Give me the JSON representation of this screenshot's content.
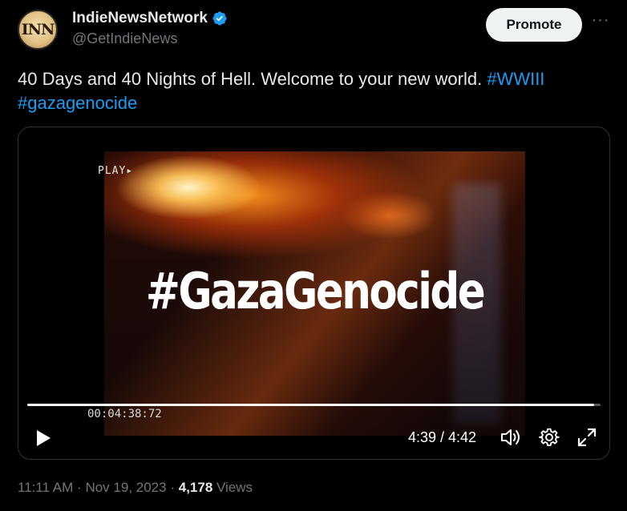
{
  "author": {
    "avatar_text": "INN",
    "name": "IndieNewsNetwork",
    "handle": "@GetIndieNews",
    "verified_icon": "verified-badge-icon"
  },
  "actions": {
    "promote_label": "Promote",
    "more_label": "···"
  },
  "tweet": {
    "text": "40 Days and 40 Nights of Hell. Welcome to your new world. ",
    "hashtags": [
      "#WWIII",
      "#gazagenocide"
    ]
  },
  "video": {
    "play_overlay": "PLAY▸",
    "title_overlay": "#GazaGenocide",
    "timecode": "00:04:38:72",
    "time_display": "4:39 / 4:42",
    "progress": 0.989
  },
  "footer": {
    "time": "11:11 AM",
    "separator": "·",
    "date": "Nov 19, 2023",
    "views_count": "4,178",
    "views_label": "Views"
  },
  "colors": {
    "accent": "#1d9bf0",
    "text": "#e7e9ea",
    "muted": "#71767b",
    "background": "#000000"
  }
}
